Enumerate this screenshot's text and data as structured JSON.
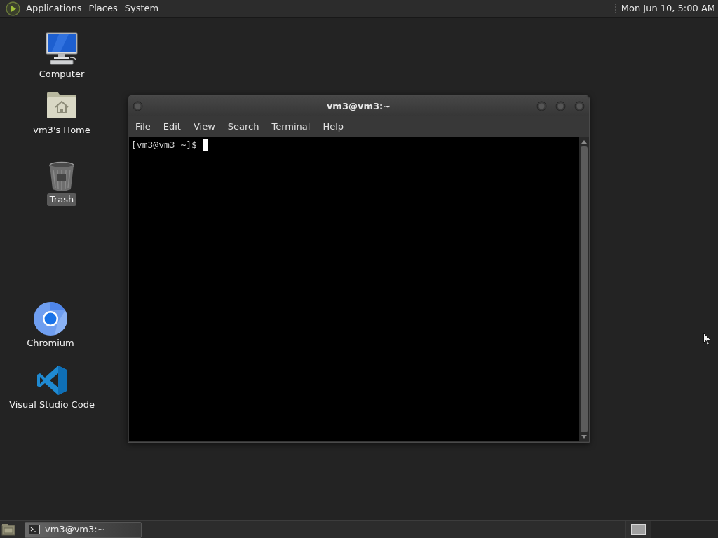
{
  "top_panel": {
    "menus": [
      {
        "label": "Applications"
      },
      {
        "label": "Places"
      },
      {
        "label": "System"
      }
    ],
    "clock": "Mon Jun 10, 5:00 AM"
  },
  "desktop_icons": [
    {
      "kind": "computer",
      "label": "Computer",
      "selected": false
    },
    {
      "kind": "home",
      "label": "vm3's Home",
      "selected": false
    },
    {
      "kind": "trash",
      "label": "Trash",
      "selected": true
    },
    {
      "kind": "chromium",
      "label": "Chromium",
      "selected": false
    },
    {
      "kind": "vscode",
      "label": "Visual Studio Code",
      "selected": false
    }
  ],
  "terminal_window": {
    "title": "vm3@vm3:~",
    "menu": [
      {
        "label": "File"
      },
      {
        "label": "Edit"
      },
      {
        "label": "View"
      },
      {
        "label": "Search"
      },
      {
        "label": "Terminal"
      },
      {
        "label": "Help"
      }
    ],
    "lines": [
      "[vm3@vm3 ~]$"
    ]
  },
  "taskbar": {
    "tasks": [
      {
        "label": "vm3@vm3:~",
        "selected": true
      }
    ]
  }
}
